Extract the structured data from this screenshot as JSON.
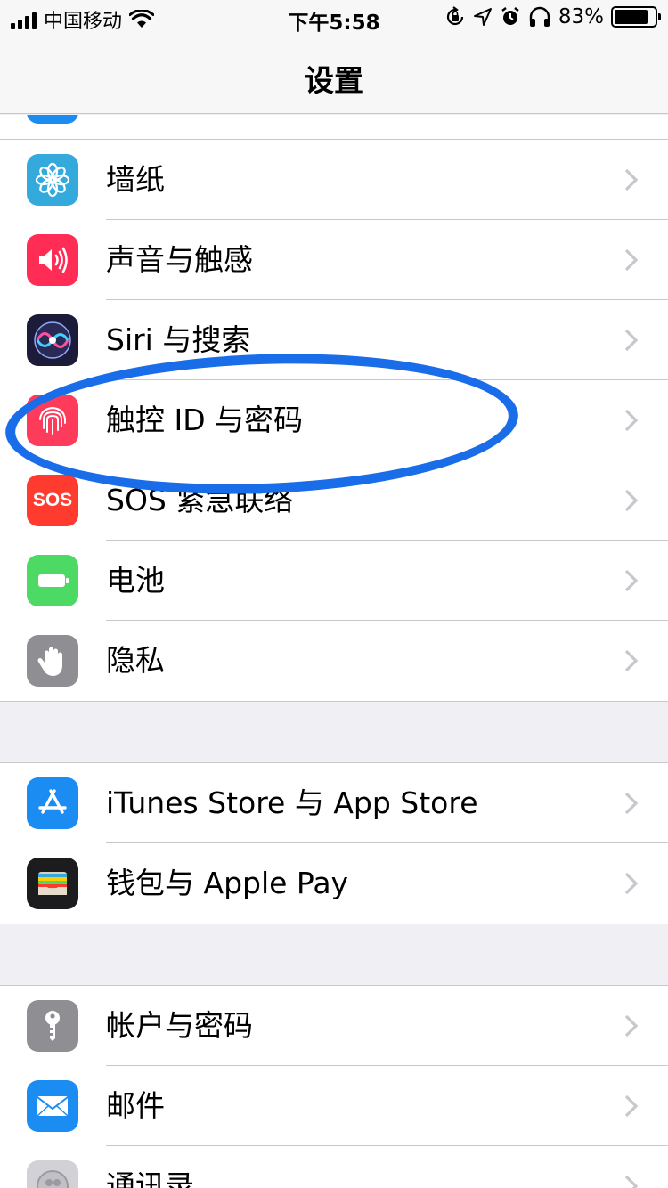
{
  "status_bar": {
    "carrier": "中国移动",
    "time": "下午5:58",
    "battery_text": "83%",
    "battery_level": 0.83
  },
  "nav": {
    "title": "设置"
  },
  "groups": [
    {
      "items": [
        {
          "label": "墙纸",
          "icon": "wallpaper-flower-icon",
          "color": "#34aadc"
        },
        {
          "label": "声音与触感",
          "icon": "speaker-icon",
          "color": "#ff2d55"
        },
        {
          "label": "Siri 与搜索",
          "icon": "siri-icon",
          "color": "#1c1c3a"
        },
        {
          "label": "触控 ID 与密码",
          "icon": "fingerprint-icon",
          "color": "#ff3b5c"
        },
        {
          "label": "SOS 紧急联络",
          "icon": "sos-icon",
          "icon_text": "SOS",
          "color": "#ff3b30"
        },
        {
          "label": "电池",
          "icon": "battery-icon",
          "color": "#4cd964"
        },
        {
          "label": "隐私",
          "icon": "hand-icon",
          "color": "#8e8e93"
        }
      ]
    },
    {
      "items": [
        {
          "label": "iTunes Store 与 App Store",
          "icon": "app-store-icon",
          "color": "#1a8cf2"
        },
        {
          "label": "钱包与 Apple Pay",
          "icon": "wallet-icon",
          "color": "#1c1c1e"
        }
      ]
    },
    {
      "items": [
        {
          "label": "帐户与密码",
          "icon": "key-icon",
          "color": "#8e8e93"
        },
        {
          "label": "邮件",
          "icon": "mail-icon",
          "color": "#1a8cf2"
        },
        {
          "label": "通讯录",
          "icon": "contacts-icon",
          "color": "#d1d1d6"
        }
      ]
    }
  ],
  "colors": {
    "annotation": "#1a6de8",
    "chevron": "#c7c7cc"
  }
}
